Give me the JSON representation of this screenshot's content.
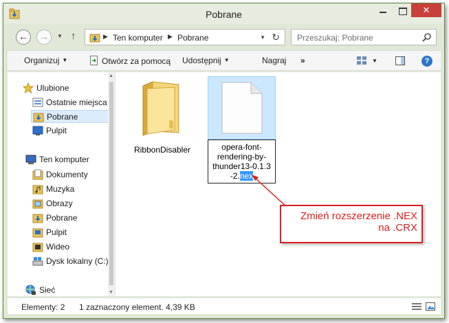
{
  "window": {
    "title": "Pobrane"
  },
  "address": {
    "parts": [
      "Ten komputer",
      "Pobrane"
    ]
  },
  "search": {
    "placeholder": "Przeszukaj: Pobrane"
  },
  "toolbar": {
    "organize": "Organizuj",
    "open_with": "Otwórz za pomocą",
    "share": "Udostępnij",
    "burn": "Nagraj",
    "more": "»",
    "help": "?"
  },
  "nav": {
    "favorites_header": "Ulubione",
    "favorites": [
      "Ostatnie miejsca",
      "Pobrane",
      "Pulpit"
    ],
    "computer_header": "Ten komputer",
    "computer": [
      "Dokumenty",
      "Muzyka",
      "Obrazy",
      "Pobrane",
      "Pulpit",
      "Wideo",
      "Dysk lokalny (C:)"
    ],
    "network": "Sieć"
  },
  "files": {
    "folder_name": "RibbonDisabler",
    "opera_line1": "opera-font-",
    "opera_line2": "rendering-by-",
    "opera_line3": "thunder13-0.1.3",
    "opera_line4_prefix": "-2.",
    "opera_line4_selected": "nex"
  },
  "status": {
    "items_count": "Elementy: 2",
    "selection": "1 zaznaczony element. 4,39 KB"
  },
  "callout": {
    "line1": "Zmień rozszerzenie .NEX",
    "line2": "na .CRX"
  },
  "colors": {
    "accent_red": "#d91f1f",
    "selection_blue": "#cce8ff",
    "highlight_blue": "#3399ff"
  }
}
